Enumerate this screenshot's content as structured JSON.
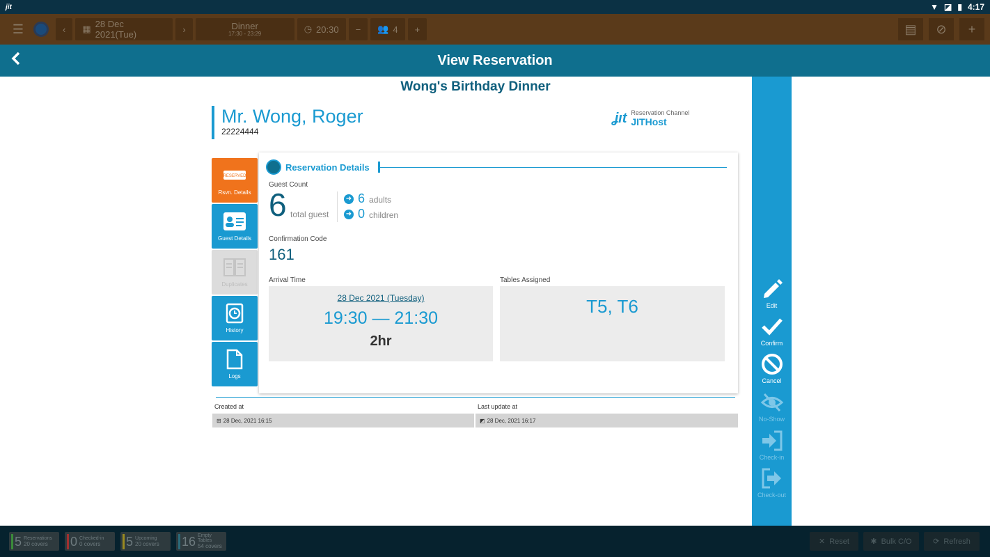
{
  "status_bar": {
    "app_icon": "jit-icon",
    "time": "4:17"
  },
  "toolbar": {
    "date": "28 Dec 2021(Tue)",
    "meal": "Dinner",
    "meal_time": "17:30 - 23:29",
    "time": "20:30",
    "party_size": "4"
  },
  "header": {
    "title": "View Reservation"
  },
  "reservation": {
    "event_title": "Wong's Birthday Dinner",
    "guest_name": "Mr. Wong, Roger",
    "phone": "22224444",
    "channel_label": "Reservation Channel",
    "channel_value": "JITHost"
  },
  "tabs": [
    {
      "label": "Rsvn. Details",
      "icon": "reserved-icon",
      "state": "active"
    },
    {
      "label": "Guest Details",
      "icon": "id-card-icon",
      "state": "normal"
    },
    {
      "label": "Duplicates",
      "icon": "duplicate-icon",
      "state": "disabled"
    },
    {
      "label": "History",
      "icon": "history-icon",
      "state": "normal"
    },
    {
      "label": "Logs",
      "icon": "document-icon",
      "state": "normal"
    }
  ],
  "details": {
    "section_title": "Reservation Details",
    "guest_count_label": "Guest Count",
    "total_guests": "6",
    "total_guest_label": "total guest",
    "adults": "6",
    "adults_label": "adults",
    "children": "0",
    "children_label": "children",
    "confirmation_label": "Confirmation Code",
    "confirmation_code": "161",
    "arrival_label": "Arrival Time",
    "arrival_date": "28 Dec 2021 (Tuesday)",
    "arrival_time": "19:30 — 21:30",
    "duration": "2hr",
    "tables_label": "Tables Assigned",
    "tables": "T5, T6"
  },
  "meta": {
    "created_label": "Created at",
    "created_value": "28 Dec, 2021 16:15",
    "updated_label": "Last update at",
    "updated_value": "28 Dec, 2021 16:17"
  },
  "actions": [
    {
      "label": "Edit",
      "enabled": true
    },
    {
      "label": "Confirm",
      "enabled": true
    },
    {
      "label": "Cancel",
      "enabled": true
    },
    {
      "label": "No-Show",
      "enabled": false
    },
    {
      "label": "Check-in",
      "enabled": false
    },
    {
      "label": "Check-out",
      "enabled": false
    }
  ],
  "bottom_stats": [
    {
      "count": "5",
      "label": "Reservations",
      "covers": "20 covers",
      "color": "#3a8a3a"
    },
    {
      "count": "0",
      "label": "Checked-in",
      "covers": "0 covers",
      "color": "#a03030"
    },
    {
      "count": "5",
      "label": "Upcoming",
      "covers": "20 covers",
      "color": "#9a8a20"
    },
    {
      "count": "16",
      "label": "Empty Tables",
      "covers": "54 covers",
      "color": "#2a6a7a"
    }
  ],
  "bottom_buttons": {
    "reset": "Reset",
    "bulk": "Bulk C/O",
    "refresh": "Refresh"
  },
  "colors": {
    "primary": "#1a9ad1",
    "header": "#0f6f8e",
    "accent": "#f0731c"
  }
}
